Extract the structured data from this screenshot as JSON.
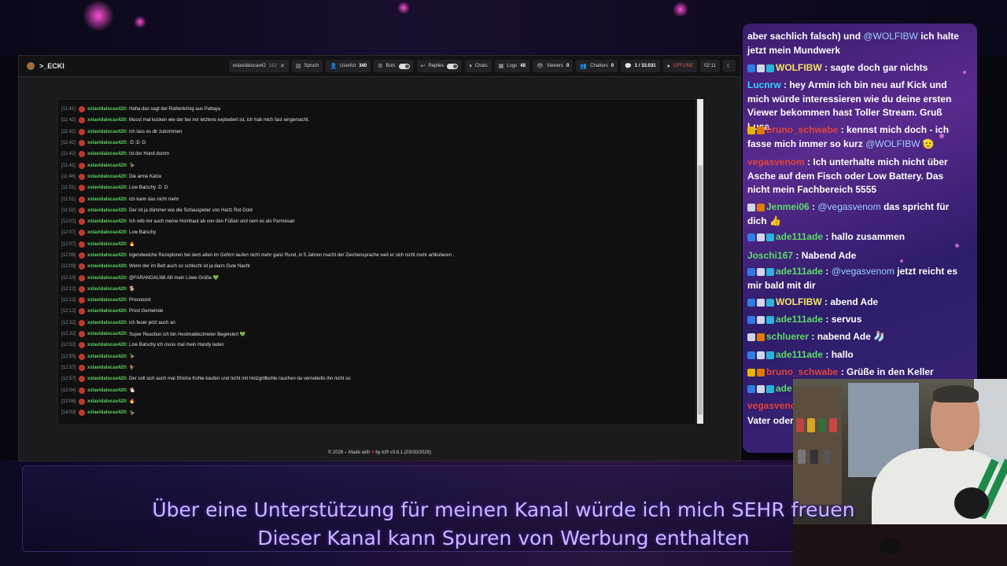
{
  "app": {
    "brand": ">_ECKI"
  },
  "toolbar": {
    "user_filter": "xxlavidalocax42",
    "user_filter_count": "162",
    "spruch": "Spruch",
    "userlist_label": "Userlist",
    "userlist_count": "340",
    "bots_label": "Bots",
    "replies_label": "Replies",
    "chats_label": "Chats",
    "logs_label": "Logs",
    "logs_count": "48",
    "viewers_label": "Viewers",
    "viewers_count": "0",
    "chatters_label": "Chatters",
    "chatters_count": "0",
    "messages_count": "1 / 33.031",
    "status": "OFFLINE",
    "clock": "02:11"
  },
  "chat_log": [
    {
      "ts": "[11:41]",
      "user": "xxlavidalocax420:",
      "msg": "Haha das sagt der Rattenkönig aus Pattaya"
    },
    {
      "ts": "[11:42]",
      "user": "xxlavidalocax420:",
      "msg": "Musst mal kucken wie der bei mir letztens explodiert ist, ich hab mich fast eingemacht."
    },
    {
      "ts": "[11:42]",
      "user": "xxlavidalocax420:",
      "msg": "ich lass es dir zukommen"
    },
    {
      "ts": "[11:42]",
      "user": "xxlavidalocax420:",
      "msg": ":D :D :D"
    },
    {
      "ts": "[11:42]",
      "user": "xxlavidalocax420:",
      "msg": "Ist der Hund dumm"
    },
    {
      "ts": "[11:43]",
      "user": "xxlavidalocax420:",
      "msg": "🦆"
    },
    {
      "ts": "[11:48]",
      "user": "xxlavidalocax420:",
      "msg": "Die arme Katze"
    },
    {
      "ts": "[11:51]",
      "user": "xxlavidalocax420:",
      "msg": "Low Batschy :D :D"
    },
    {
      "ts": "[11:51]",
      "user": "xxlavidalocax420:",
      "msg": "ich kann das nicht mehr"
    },
    {
      "ts": "[11:52]",
      "user": "xxlavidalocax420:",
      "msg": "Der ist ja dümmer wie die Schauspieler von Hartz Rot Gold"
    },
    {
      "ts": "[12:01]",
      "user": "xxlavidalocax420:",
      "msg": "Ich reib mir auch meine Hornhaut ab von den Füßen und nem es als Parmesan"
    },
    {
      "ts": "[12:07]",
      "user": "xxlavidalocax420:",
      "msg": "Low Batschy"
    },
    {
      "ts": "[12:07]",
      "user": "xxlavidalocax420:",
      "msg": "🔥"
    },
    {
      "ts": "[12:08]",
      "user": "xxlavidalocax420:",
      "msg": "Irgendwelche Rezeptoren bei dem alten im Gehirn laufen nicht mehr ganz Rund, in 5 Jahren macht der Zeichensprache weil er sich nicht mehr artikulieren ."
    },
    {
      "ts": "[12:09]",
      "user": "xxlavidalocax420:",
      "msg": "Wenn der im Bett auch so schlecht ist ja dann Gute Nacht"
    },
    {
      "ts": "[12:10]",
      "user": "xxlavidalocax420:",
      "msg": "@FARANGALI88 Alli mein Löwe Grüße 💚"
    },
    {
      "ts": "[12:12]",
      "user": "xxlavidalocax420:",
      "msg": "🐕"
    },
    {
      "ts": "[12:12]",
      "user": "xxlavidalocax420:",
      "msg": "Prooooost"
    },
    {
      "ts": "[12:12]",
      "user": "xxlavidalocax420:",
      "msg": "Prost Gemeinde"
    },
    {
      "ts": "[12:32]",
      "user": "xxlavidalocax420:",
      "msg": "ich feuer jetzt auch an"
    },
    {
      "ts": "[12:32]",
      "user": "xxlavidalocax420:",
      "msg": "Super Reaction ich bin Hestmaldezimeter Begeistert 💚"
    },
    {
      "ts": "[12:52]",
      "user": "xxlavidalocax420:",
      "msg": "Low Batschy ich muss mal mein Handy laden"
    },
    {
      "ts": "[12:55]",
      "user": "xxlavidalocax420:",
      "msg": "🦆"
    },
    {
      "ts": "[12:57]",
      "user": "xxlavidalocax420:",
      "msg": "🐓"
    },
    {
      "ts": "[12:57]",
      "user": "xxlavidalocax420:",
      "msg": "Der soll sich auch mal Shisha Kohle kaufen und nicht mit Holzgrillkohle rauchen da vernebelts ihn nicht so"
    },
    {
      "ts": "[13:04]",
      "user": "xxlavidalocax420:",
      "msg": "🐔"
    },
    {
      "ts": "[13:06]",
      "user": "xxlavidalocax420:",
      "msg": "🔥"
    },
    {
      "ts": "[14:03]",
      "user": "xxlavidalocax420:",
      "msg": "🦆"
    }
  ],
  "footer": {
    "prefix": "© 2026 – Made with",
    "heart": "♥",
    "suffix": "by tcR  v3.6.1 (03/30/2026)"
  },
  "overlay_chat": [
    {
      "user": "",
      "user_color": "#ffffff",
      "msg": "aber sachlich falsch) und ",
      "mention": "@WOLFIBW",
      "msg2": " ich halte jetzt mein Mundwerk",
      "badges": []
    },
    {
      "user": "WOLFIBW",
      "user_color": "#f5e36a",
      "msg": " : sagte doch gar nichts",
      "mention": "",
      "msg2": "",
      "badges": [
        "blue",
        "gray",
        "cyan"
      ]
    },
    {
      "user": "Lucnrw",
      "user_color": "#35d0ff",
      "msg": " : hey Armin ich bin neu auf Kick und mich würde interessieren wie du deine ersten Viewer bekommen hast Toller Stream. Gruß Luca",
      "mention": "",
      "msg2": "",
      "badges": []
    },
    {
      "user": "bruno_schwabe",
      "user_color": "#e0443a",
      "msg": " : kennst mich doch - ich fasse mich immer so kurz ",
      "mention": "@WOLFIBW",
      "msg2": " 🫡",
      "badges": [
        "gold",
        "orange"
      ]
    },
    {
      "user": "vegasvenom",
      "user_color": "#e0443a",
      "msg": " : Ich unterhalte mich nicht über Asche auf dem Fisch oder Low Battery. Das nicht mein Fachbereich 5555",
      "mention": "",
      "msg2": "",
      "badges": []
    },
    {
      "user": "Jenmei06",
      "user_color": "#5cdb6a",
      "msg": " : ",
      "mention": "@vegasvenom",
      "msg2": " das spricht für dich 👍",
      "badges": [
        "gray",
        "orange"
      ]
    },
    {
      "user": "ade111ade",
      "user_color": "#5cdb6a",
      "msg": " : hallo zusammen",
      "mention": "",
      "msg2": "",
      "badges": [
        "blue",
        "gray",
        "cyan"
      ]
    },
    {
      "user": "Joschi167",
      "user_color": "#5cdb6a",
      "msg": " : Nabend Ade",
      "mention": "",
      "msg2": "",
      "badges": []
    },
    {
      "user": "ade111ade",
      "user_color": "#5cdb6a",
      "msg": " : ",
      "mention": "@vegasvenom",
      "msg2": " jetzt reicht es mir bald mit dir",
      "badges": [
        "blue",
        "gray",
        "cyan"
      ]
    },
    {
      "user": "WOLFIBW",
      "user_color": "#f5e36a",
      "msg": " : abend Ade",
      "mention": "",
      "msg2": "",
      "badges": [
        "blue",
        "gray",
        "cyan"
      ]
    },
    {
      "user": "ade111ade",
      "user_color": "#5cdb6a",
      "msg": " : servus",
      "mention": "",
      "msg2": "",
      "badges": [
        "blue",
        "gray",
        "cyan"
      ]
    },
    {
      "user": "schluerer",
      "user_color": "#5cdb6a",
      "msg": " : nabend Ade",
      "mention": "",
      "msg2": " 🧦",
      "badges": [
        "gray",
        "orange"
      ]
    },
    {
      "user": "ade111ade",
      "user_color": "#5cdb6a",
      "msg": " : hallo",
      "mention": "",
      "msg2": "",
      "badges": [
        "blue",
        "gray",
        "cyan"
      ]
    },
    {
      "user": "bruno_schwabe",
      "user_color": "#e0443a",
      "msg": " : Grüße in den Keller",
      "mention": "",
      "msg2": "",
      "badges": [
        "gold",
        "orange"
      ]
    },
    {
      "user": "ade",
      "user_color": "#5cdb6a",
      "msg": "",
      "mention": "",
      "msg2": "",
      "badges": [
        "blue",
        "gray",
        "cyan"
      ]
    },
    {
      "user": "vegasvenom",
      "user_color": "#e0443a",
      "msg": "",
      "mention": "",
      "msg2": "",
      "badges": []
    },
    {
      "user": "",
      "user_color": "#ffffff",
      "msg": "Vater oder",
      "mention": "",
      "msg2": "",
      "badges": []
    }
  ],
  "subtitles": {
    "line1": "Über eine Unterstützung für meinen Kanal würde ich mich SEHR freuen",
    "line2": "Dieser Kanal kann Spuren von Werbung enthalten"
  }
}
